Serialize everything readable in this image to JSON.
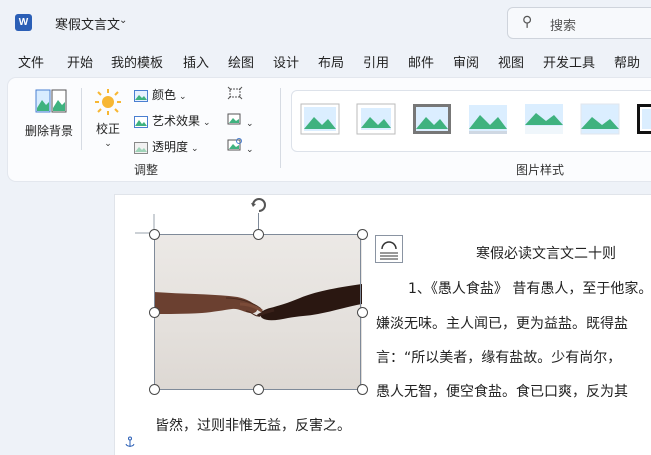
{
  "titlebar": {
    "app_icon_letter": "W",
    "doc_title": "寒假文言文",
    "search_placeholder": "搜索"
  },
  "tabs": [
    "文件",
    "开始",
    "我的模板",
    "插入",
    "绘图",
    "设计",
    "布局",
    "引用",
    "邮件",
    "审阅",
    "视图",
    "开发工具",
    "帮助"
  ],
  "ribbon": {
    "remove_bg": "删除背景",
    "correct": "校正",
    "color": "颜色",
    "artistic": "艺术效果",
    "transparency": "透明度",
    "group_adjust": "调整",
    "group_styles": "图片样式"
  },
  "document": {
    "heading": "寒假必读文言文二十则",
    "lines": [
      "1、《愚人食盐》 昔有愚人，至于他家。",
      "嫌淡无味。主人闻已，更为益盐。既得盐",
      "言：“所以美者，缘有盐故。少有尚尔，",
      "愚人无智，便空食盐。食已口爽，反为其",
      "皆然，过则非惟无益，反害之。"
    ]
  },
  "colors": {
    "accent": "#2b5fb6",
    "background": "#eef2f8"
  }
}
